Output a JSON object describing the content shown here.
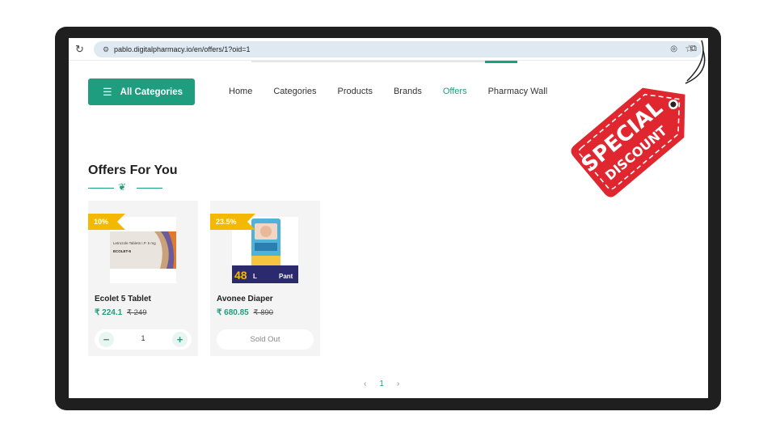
{
  "browser": {
    "url": "pablo.digitalpharmacy.io/en/offers/1?oid=1"
  },
  "header": {
    "categories_button": "All Categories",
    "nav": [
      "Home",
      "Categories",
      "Products",
      "Brands",
      "Offers",
      "Pharmacy Wall"
    ],
    "active_nav": "Offers"
  },
  "section": {
    "title": "Offers For You"
  },
  "products": [
    {
      "badge": "10%",
      "name": "Ecolet 5 Tablet",
      "price": "₹ 224.1",
      "old_price": "₹ 249",
      "quantity": "1",
      "pack_text": "Letrozole Tablets I.P. 5 mg",
      "pack_brand": "ECOLET-5"
    },
    {
      "badge": "23.5%",
      "name": "Avonee Diaper",
      "price": "₹ 680.85",
      "old_price": "₹ 890",
      "status": "Sold Out",
      "pack_count": "48",
      "pack_size": "L",
      "pack_type": "Pant"
    }
  ],
  "pagination": {
    "prev": "‹",
    "current": "1",
    "next": "›"
  },
  "promo_tag": {
    "line1": "SPECIAL",
    "line2": "DISCOUNT"
  },
  "colors": {
    "brand": "#1e9e7e",
    "badge": "#f5b800",
    "tag": "#e0262f",
    "frame": "#1f1f1f"
  }
}
